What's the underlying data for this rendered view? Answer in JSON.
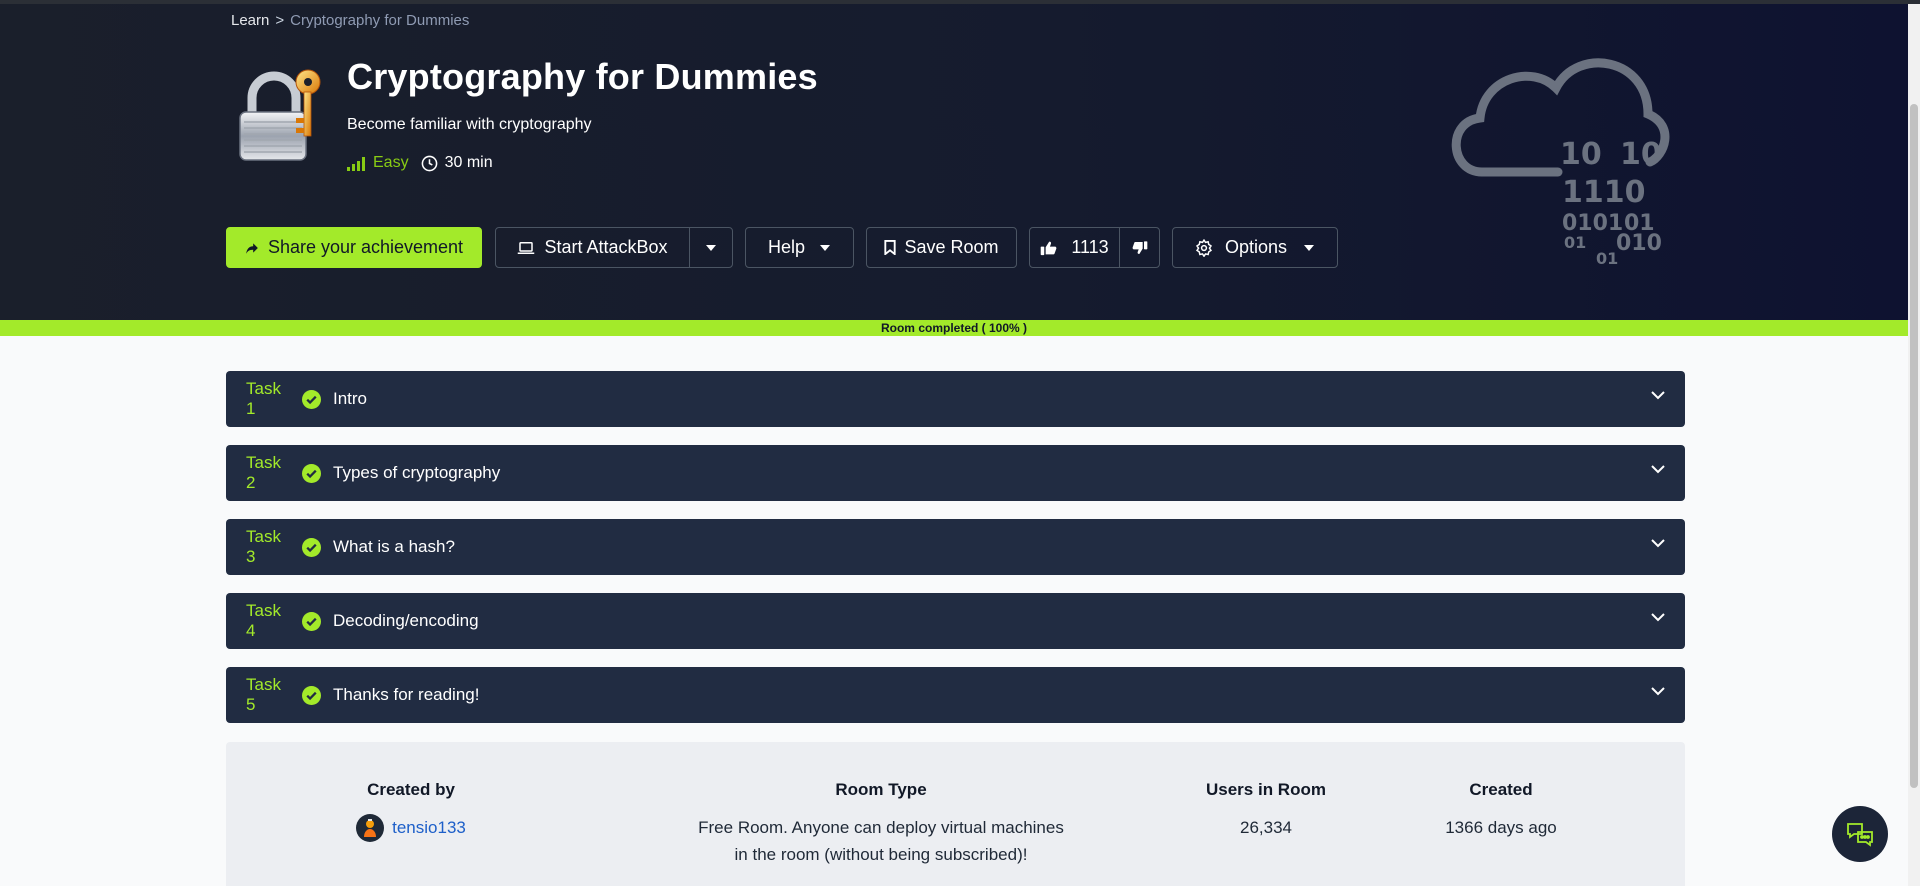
{
  "breadcrumb": {
    "root": "Learn",
    "separator": ">",
    "current": "Cryptography for Dummies"
  },
  "room": {
    "title": "Cryptography for Dummies",
    "subtitle": "Become familiar with cryptography",
    "difficulty": "Easy",
    "duration": "30 min",
    "icon": "padlock-with-key-icon",
    "art": "cloud-binary-icon"
  },
  "actions": {
    "share_label": "Share your achievement",
    "attackbox_label": "Start AttackBox",
    "help_label": "Help",
    "save_label": "Save Room",
    "upvotes": "1113",
    "options_label": "Options"
  },
  "progress": {
    "label": "Room completed ( 100% )",
    "percent": 100
  },
  "tasks": [
    {
      "number": "Task 1",
      "title": "Intro",
      "completed": true
    },
    {
      "number": "Task 2",
      "title": "Types of cryptography",
      "completed": true
    },
    {
      "number": "Task 3",
      "title": "What is a hash?",
      "completed": true
    },
    {
      "number": "Task 4",
      "title": "Decoding/encoding",
      "completed": true
    },
    {
      "number": "Task 5",
      "title": "Thanks for reading!",
      "completed": true
    }
  ],
  "info": {
    "created_by_label": "Created by",
    "creator": "tensio133",
    "room_type_label": "Room Type",
    "room_type_line1": "Free Room. Anyone can deploy virtual machines",
    "room_type_line2": "in the room (without being subscribed)!",
    "users_label": "Users in Room",
    "users": "26,334",
    "created_label": "Created",
    "created": "1366 days ago"
  },
  "colors": {
    "accent": "#a3ea2a",
    "hero_bg": "#151b2e",
    "task_bg": "#212c42",
    "link": "#1d5fc9"
  }
}
